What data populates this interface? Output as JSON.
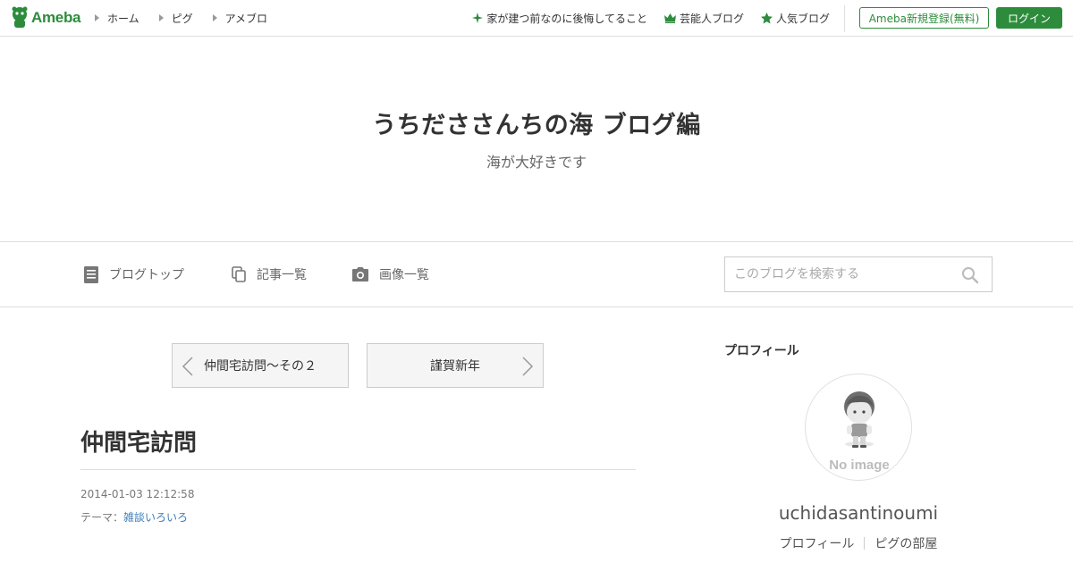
{
  "header": {
    "logo_text": "Ameba",
    "global_nav": [
      {
        "label": "ホーム"
      },
      {
        "label": "ピグ"
      },
      {
        "label": "アメブロ"
      }
    ],
    "promo_links": [
      {
        "label": "家が建つ前なのに後悔してること",
        "icon": "sparkle-icon"
      },
      {
        "label": "芸能人ブログ",
        "icon": "crown-icon"
      },
      {
        "label": "人気ブログ",
        "icon": "star-icon"
      }
    ],
    "register_label": "Ameba新規登録(無料)",
    "login_label": "ログイン"
  },
  "blog": {
    "title": "うちだささんちの海 ブログ編",
    "description": "海が大好きです"
  },
  "blog_nav": {
    "items": [
      {
        "label": "ブログトップ",
        "icon": "document-icon"
      },
      {
        "label": "記事一覧",
        "icon": "copy-icon"
      },
      {
        "label": "画像一覧",
        "icon": "camera-icon"
      }
    ],
    "search_placeholder": "このブログを検索する"
  },
  "pager": {
    "prev_label": "仲間宅訪問～その２",
    "next_label": "謹賀新年"
  },
  "entry": {
    "title": "仲間宅訪問",
    "date": "2014-01-03 12:12:58",
    "theme_prefix": "テーマ：",
    "theme_link": "雑談いろいろ"
  },
  "sidebar": {
    "heading": "プロフィール",
    "avatar_caption": "No image",
    "username": "uchidasantinoumi",
    "links": [
      {
        "label": "プロフィール"
      },
      {
        "label": "ピグの部屋"
      }
    ]
  },
  "colors": {
    "brand_green": "#2d8c3c",
    "link_blue": "#3d7cb8"
  }
}
